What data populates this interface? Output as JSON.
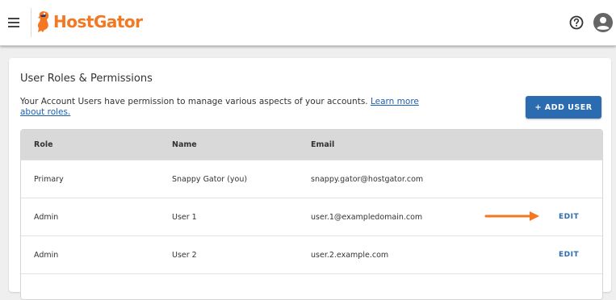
{
  "header": {
    "logo_text": "HostGator",
    "brand_color": "#f47721",
    "icons": [
      "menu-icon",
      "help-icon",
      "avatar-icon"
    ]
  },
  "card": {
    "title": "User Roles & Permissions",
    "description": "Your Account Users have permission to manage various aspects of your accounts. ",
    "learn_more": "Learn more about roles.",
    "add_user_label": "+ ADD USER",
    "accent_color": "#2b6cb0"
  },
  "table": {
    "columns": [
      "Role",
      "Name",
      "Email"
    ],
    "rows": [
      {
        "role": "Primary",
        "name": "Snappy Gator (you)",
        "email": "snappy.gator@hostgator.com",
        "action": ""
      },
      {
        "role": "Admin",
        "name": "User 1",
        "email": "user.1@exampledomain.com",
        "action": "EDIT"
      },
      {
        "role": "Admin",
        "name": "User 2",
        "email": "user.2.example.com",
        "action": "EDIT"
      }
    ]
  },
  "annotation": {
    "arrow_color": "#f47721"
  }
}
